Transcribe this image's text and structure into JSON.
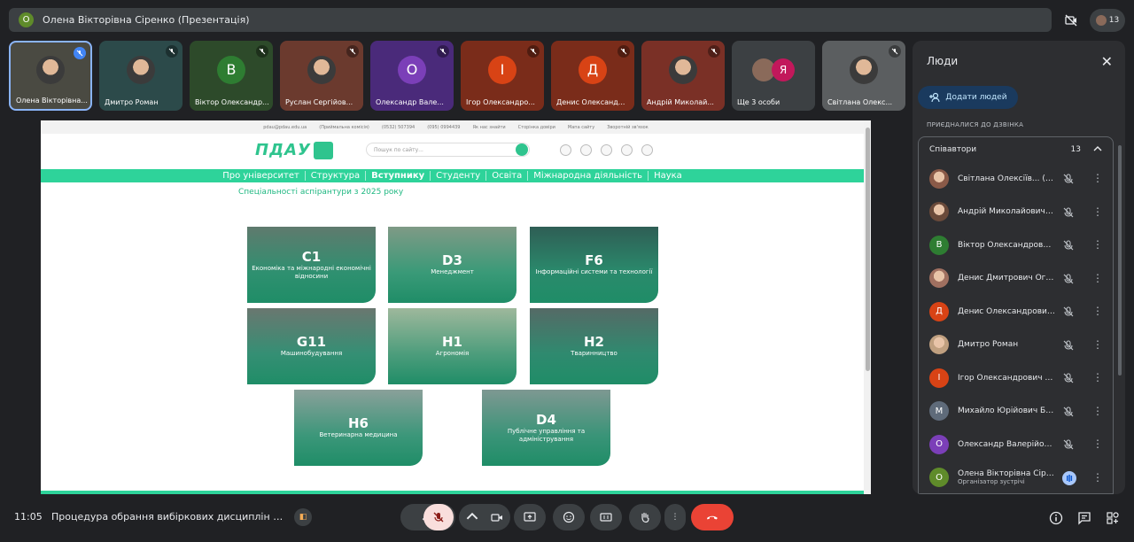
{
  "topbar": {
    "presenter_initial": "О",
    "title": "Олена Вікторівна Сіренко (Презентація)",
    "participant_count": "13"
  },
  "tiles": [
    {
      "name": "Олена Вікторівна...",
      "kind": "photo",
      "active": true
    },
    {
      "name": "Дмитро Роман",
      "kind": "photo"
    },
    {
      "name": "Віктор Олександр...",
      "kind": "letter",
      "letter": "В",
      "color": "#2e7d32"
    },
    {
      "name": "Руслан Сергійов...",
      "kind": "photo"
    },
    {
      "name": "Олександр Вале...",
      "kind": "letter",
      "letter": "О",
      "color": "#7b3fb8"
    },
    {
      "name": "Ігор Олександро...",
      "kind": "letter",
      "letter": "І",
      "color": "#d84315"
    },
    {
      "name": "Денис Олександ...",
      "kind": "letter",
      "letter": "Д",
      "color": "#d84315"
    },
    {
      "name": "Андрій Миколай...",
      "kind": "photo"
    },
    {
      "name": "Ще 3 особи",
      "kind": "more",
      "letter": "Я"
    },
    {
      "name": "Світлана Олекс...",
      "kind": "photo"
    }
  ],
  "site": {
    "top_links": [
      "pdau@pdau.edu.ua",
      "(Приймальна комісія)",
      "(0532) 507394",
      "(095) 0994439",
      "Як нас знайти",
      "Сторінка довіри",
      "Мапа сайту",
      "Зворотній зв'язок"
    ],
    "logo_text": "ПДАУ",
    "search_placeholder": "Пошук по сайту...",
    "nav": [
      "Про університет",
      "Структура",
      "Вступнику",
      "Студенту",
      "Освіта",
      "Міжнародна діяльність",
      "Наука"
    ],
    "heading": "Спеціальності аспірантури з 2025 року",
    "cards": [
      {
        "code": "C1",
        "label": "Економіка та міжнародні економічні відносини"
      },
      {
        "code": "D3",
        "label": "Менеджмент"
      },
      {
        "code": "F6",
        "label": "Інформаційні системи та технології"
      },
      {
        "code": "G11",
        "label": "Машинобудування"
      },
      {
        "code": "H1",
        "label": "Агрономія"
      },
      {
        "code": "H2",
        "label": "Тваринництво"
      },
      {
        "code": "H6",
        "label": "Ветеринарна медицина"
      },
      {
        "code": "D4",
        "label": "Публічне управління та адміністрування"
      }
    ]
  },
  "panel": {
    "title": "Люди",
    "add_label": "Додати людей",
    "joined_label": "ПРИЄДНАЛИСЯ ДО ДЗВІНКА",
    "group_label": "Співавтори",
    "group_count": "13",
    "people": [
      {
        "name": "Світлана Олексіїв... (Ви)",
        "kind": "photo"
      },
      {
        "name": "Андрій Миколайович Р...",
        "kind": "photo"
      },
      {
        "name": "Віктор Олександрович...",
        "letter": "В",
        "color": "#2e7d32"
      },
      {
        "name": "Денис Дмитрович Огар",
        "kind": "photo"
      },
      {
        "name": "Денис Олександрович...",
        "letter": "Д",
        "color": "#d84315"
      },
      {
        "name": "Дмитро Роман",
        "kind": "photo"
      },
      {
        "name": "Ігор Олександрович П...",
        "letter": "І",
        "color": "#d84315"
      },
      {
        "name": "Михайло Юрійович Ба...",
        "letter": "М",
        "color": "#5f6b7a"
      },
      {
        "name": "Олександр Валерійов...",
        "letter": "О",
        "color": "#7b3fb8"
      },
      {
        "name": "Олена Вікторівна Сіре...",
        "letter": "О",
        "color": "#5f8b2a",
        "sub": "Організатор зустрічі"
      }
    ]
  },
  "bottom": {
    "time": "11:05",
    "meeting_title": "Процедура обрання вибіркових дисциплін для ас..."
  }
}
